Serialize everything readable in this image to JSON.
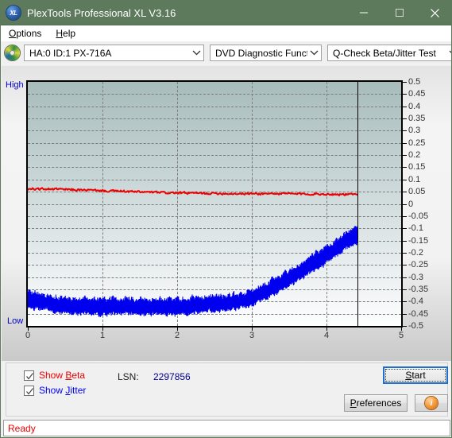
{
  "window": {
    "title": "PlexTools Professional XL V3.16",
    "icon": "xl-app-icon",
    "minimize_label": "minimize-icon",
    "maximize_label": "maximize-icon",
    "close_label": "close-icon",
    "titlebar_color": "#5d7a5d"
  },
  "menu": {
    "items": [
      {
        "label": "Options",
        "accel": "O"
      },
      {
        "label": "Help",
        "accel": "H"
      }
    ]
  },
  "toolbar": {
    "drive_icon": "disc-icon",
    "drive": {
      "value": "HA:0 ID:1  PX-716A"
    },
    "function": {
      "value": "DVD Diagnostic Functions"
    },
    "test": {
      "value": "Q-Check Beta/Jitter Test"
    }
  },
  "chart_data": {
    "type": "line",
    "title": "",
    "xlabel": "",
    "ylabel": "",
    "xlim": [
      0,
      5
    ],
    "ylim": [
      -0.5,
      0.5
    ],
    "grid": true,
    "x_ticks": [
      0,
      1,
      2,
      3,
      4,
      5
    ],
    "y_ticks": [
      0.5,
      0.45,
      0.4,
      0.35,
      0.3,
      0.25,
      0.2,
      0.15,
      0.1,
      0.05,
      0,
      -0.05,
      -0.1,
      -0.15,
      -0.2,
      -0.25,
      -0.3,
      -0.35,
      -0.4,
      -0.45,
      -0.5
    ],
    "left_axis_top_label": "High",
    "left_axis_bottom_label": "Low",
    "marker_x": 4.42,
    "data_end_x": 4.42,
    "legend": [
      "Show Beta",
      "Show Jitter"
    ],
    "series": [
      {
        "name": "Beta",
        "color": "#ee0000",
        "x": [
          0.0,
          0.2,
          0.4,
          0.6,
          0.8,
          1.0,
          1.2,
          1.4,
          1.6,
          1.8,
          2.0,
          2.2,
          2.4,
          2.6,
          2.8,
          3.0,
          3.2,
          3.4,
          3.6,
          3.8,
          4.0,
          4.2,
          4.42
        ],
        "values": [
          0.062,
          0.061,
          0.06,
          0.058,
          0.056,
          0.054,
          0.052,
          0.05,
          0.048,
          0.046,
          0.045,
          0.044,
          0.043,
          0.043,
          0.042,
          0.042,
          0.042,
          0.042,
          0.041,
          0.041,
          0.04,
          0.039,
          0.038
        ],
        "noise_amplitude": 0.006
      },
      {
        "name": "Jitter",
        "color": "#0000ee",
        "x": [
          0.0,
          0.2,
          0.4,
          0.6,
          0.8,
          1.0,
          1.2,
          1.4,
          1.6,
          1.8,
          2.0,
          2.2,
          2.4,
          2.6,
          2.8,
          3.0,
          3.2,
          3.4,
          3.6,
          3.8,
          4.0,
          4.2,
          4.42
        ],
        "values": [
          -0.4,
          -0.405,
          -0.415,
          -0.42,
          -0.423,
          -0.425,
          -0.423,
          -0.422,
          -0.424,
          -0.425,
          -0.424,
          -0.42,
          -0.414,
          -0.41,
          -0.405,
          -0.385,
          -0.355,
          -0.322,
          -0.288,
          -0.25,
          -0.21,
          -0.165,
          -0.125
        ],
        "band_half_width": 0.035
      }
    ]
  },
  "controls": {
    "show_beta": {
      "label": "Show Beta",
      "accel": "B",
      "checked": true,
      "color": "#ee0000"
    },
    "show_jitter": {
      "label": "Show Jitter",
      "accel": "J",
      "checked": true,
      "color": "#0000ee"
    },
    "lsn_label": "LSN:",
    "lsn_value": "2297856",
    "start_button": {
      "label": "Start",
      "accel": "S"
    },
    "preferences_button": {
      "label": "Preferences",
      "accel": "P"
    },
    "info_button": {
      "glyph": "i"
    }
  },
  "status": {
    "text": "Ready",
    "color": "#ee0000"
  }
}
